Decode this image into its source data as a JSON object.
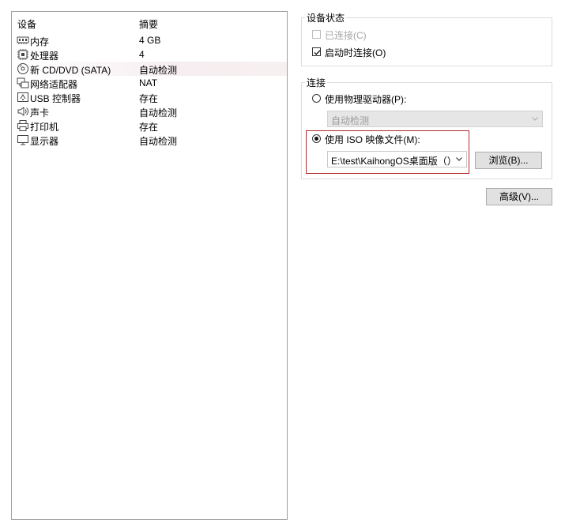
{
  "device_list": {
    "header": {
      "device": "设备",
      "summary": "摘要"
    },
    "rows": [
      {
        "icon": "memory-icon",
        "name": "内存",
        "summary": "4 GB"
      },
      {
        "icon": "processor-icon",
        "name": "处理器",
        "summary": "4"
      },
      {
        "icon": "cd-dvd-icon",
        "name": "新 CD/DVD (SATA)",
        "summary": "自动检测"
      },
      {
        "icon": "network-adapter-icon",
        "name": "网络适配器",
        "summary": "NAT"
      },
      {
        "icon": "usb-controller-icon",
        "name": "USB 控制器",
        "summary": "存在"
      },
      {
        "icon": "sound-card-icon",
        "name": "声卡",
        "summary": "自动检测"
      },
      {
        "icon": "printer-icon",
        "name": "打印机",
        "summary": "存在"
      },
      {
        "icon": "display-icon",
        "name": "显示器",
        "summary": "自动检测"
      }
    ]
  },
  "device_status": {
    "title": "设备状态",
    "connected_label": "已连接(C)",
    "connect_at_power_on_label": "启动时连接(O)"
  },
  "connection": {
    "title": "连接",
    "physical_drive_label": "使用物理驱动器(P):",
    "physical_drive_value": "自动检测",
    "iso_label": "使用 ISO 映像文件(M):",
    "iso_value": "E:\\test\\KaihongOS桌面版（）",
    "browse_label": "浏览(B)..."
  },
  "advanced_label": "高级(V)..."
}
